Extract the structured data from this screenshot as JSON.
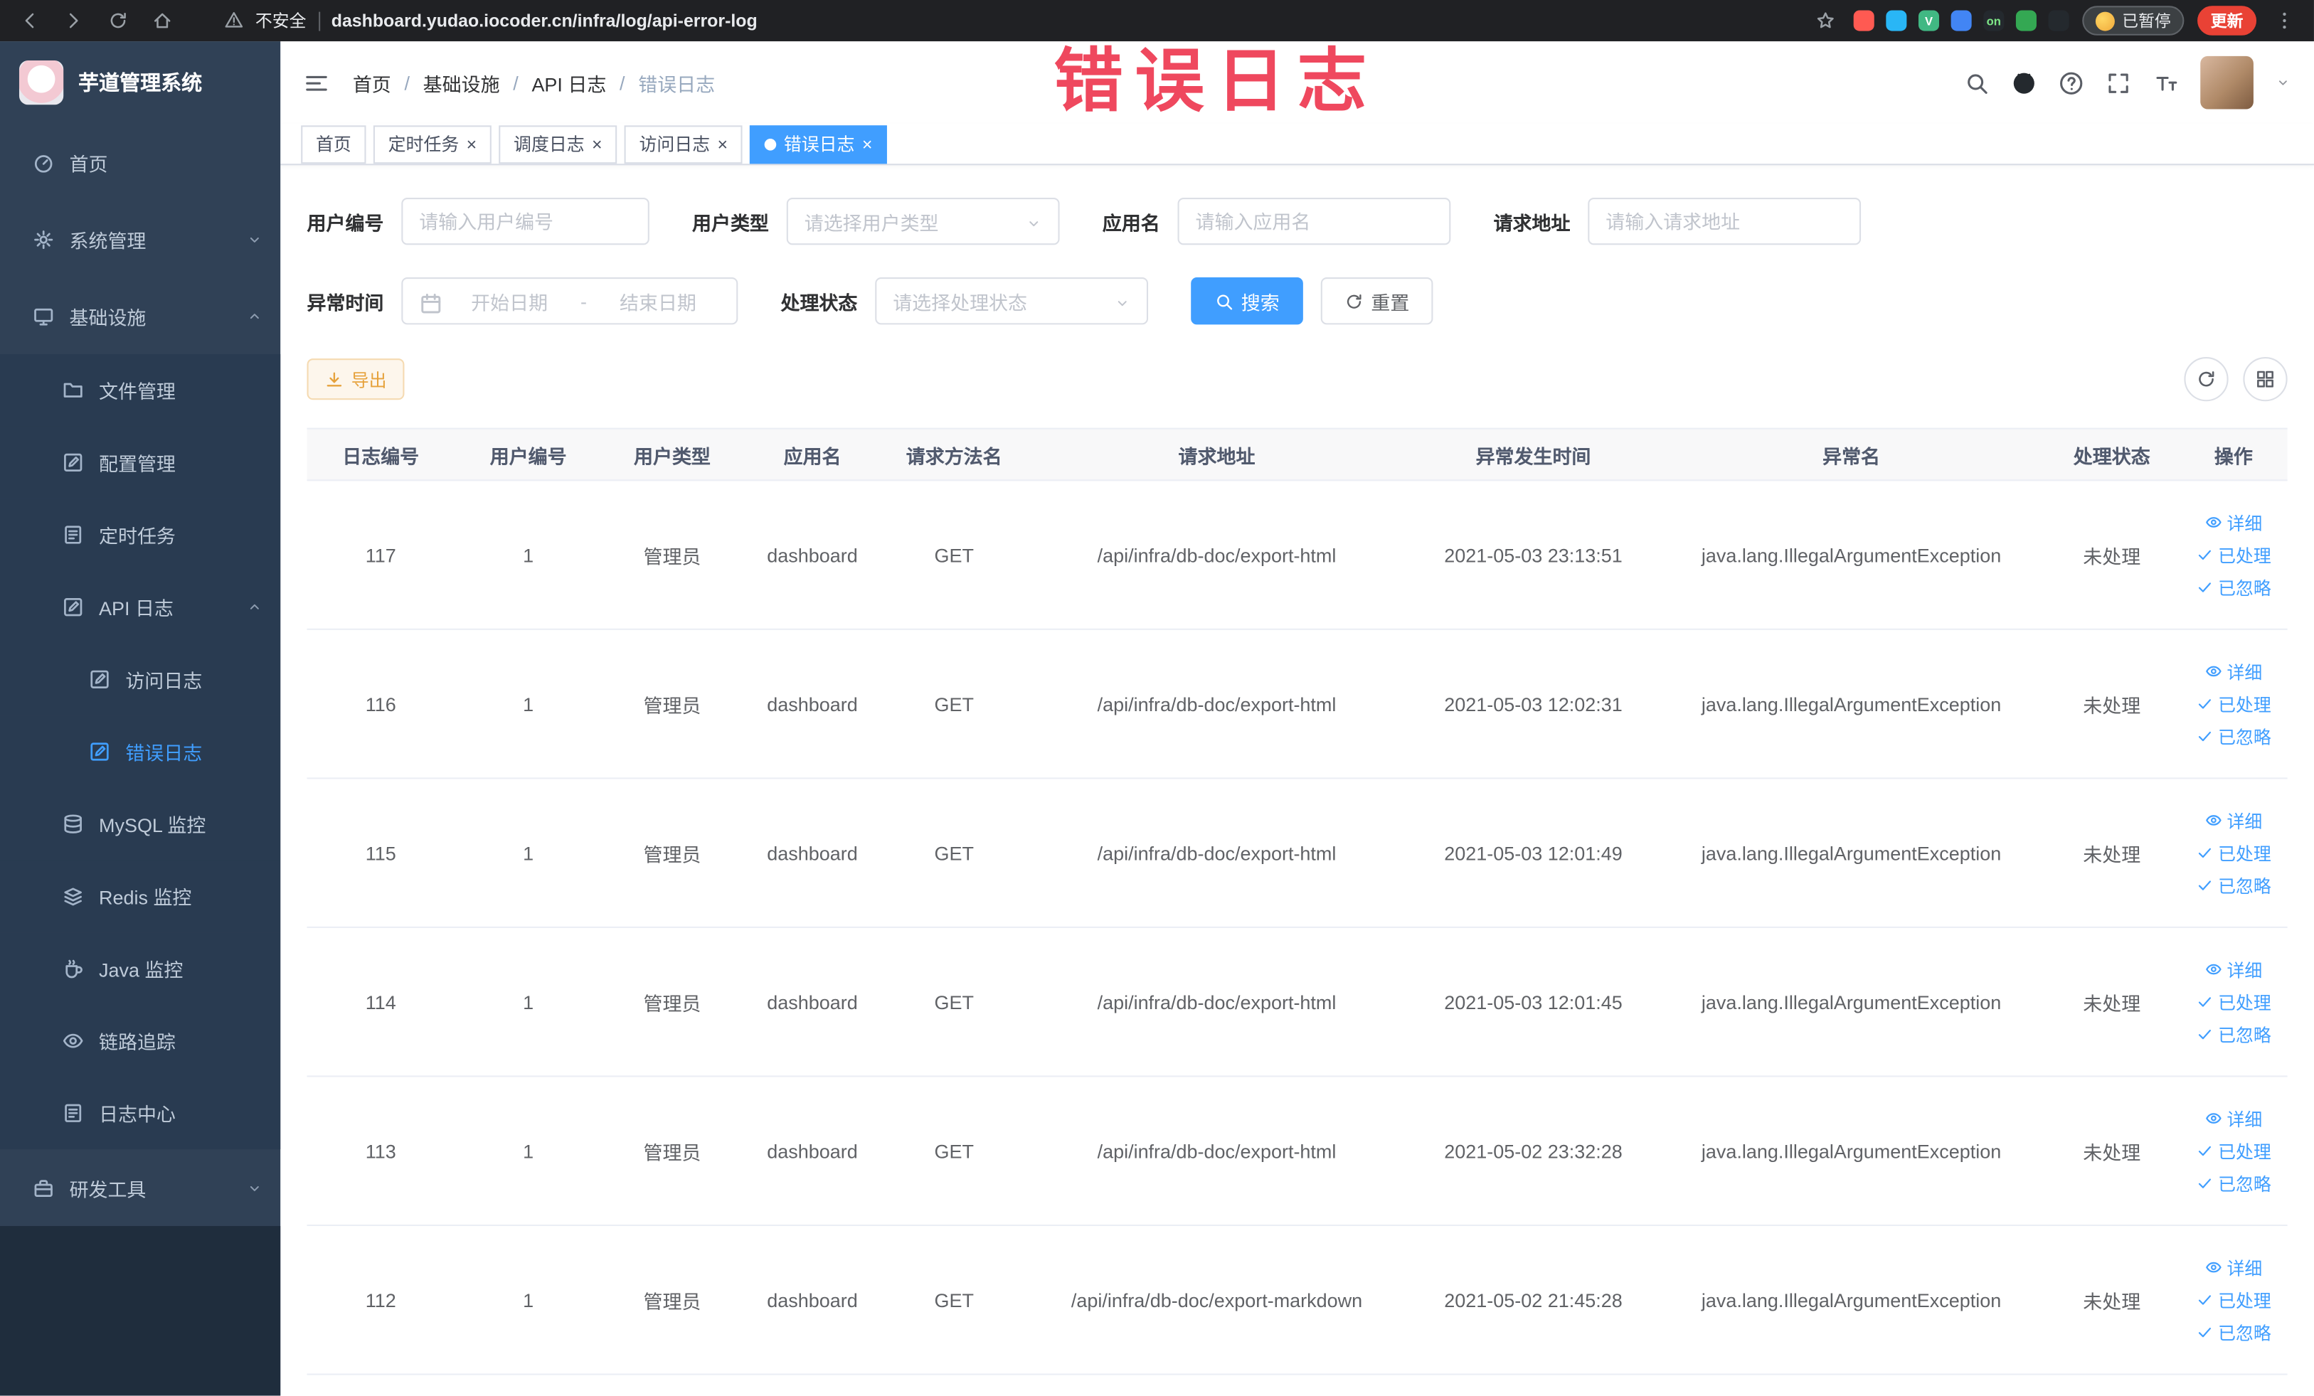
{
  "browser": {
    "security_label": "不安全",
    "url": "dashboard.yudao.iocoder.cn/infra/log/api-error-log",
    "paused_chip": "已暂停",
    "update_button": "更新",
    "extensions": [
      {
        "key": "ext-red",
        "color": "#ff5a52",
        "text": ""
      },
      {
        "key": "ext-drop",
        "color": "#29b6f6",
        "text": ""
      },
      {
        "key": "ext-vue",
        "color": "#41b883",
        "text": "V"
      },
      {
        "key": "ext-grid",
        "color": "#4285f4",
        "text": ""
      },
      {
        "key": "ext-on",
        "color": "#24292e",
        "text": "on",
        "text_color": "#7ee787"
      },
      {
        "key": "ext-green",
        "color": "#34a853",
        "text": ""
      },
      {
        "key": "ext-dark",
        "color": "#24292e",
        "text": ""
      }
    ]
  },
  "watermark": "错误日志",
  "sidebar": {
    "logo_title": "芋道管理系统",
    "items": [
      {
        "key": "home",
        "label": "首页",
        "icon": "dashboard",
        "level": 1
      },
      {
        "key": "system-mgmt",
        "label": "系统管理",
        "icon": "gear",
        "level": 1,
        "chevron": "down"
      },
      {
        "key": "infrastructure",
        "label": "基础设施",
        "icon": "monitor",
        "level": 1,
        "chevron": "up"
      },
      {
        "key": "file-mgmt",
        "label": "文件管理",
        "icon": "folder",
        "level": 2
      },
      {
        "key": "config-mgmt",
        "label": "配置管理",
        "icon": "edit-square",
        "level": 2
      },
      {
        "key": "scheduled-task",
        "label": "定时任务",
        "icon": "list",
        "level": 2
      },
      {
        "key": "api-log",
        "label": "API 日志",
        "icon": "edit-square",
        "level": 2,
        "chevron": "up"
      },
      {
        "key": "access-log",
        "label": "访问日志",
        "icon": "edit-square",
        "level": 3
      },
      {
        "key": "error-log",
        "label": "错误日志",
        "icon": "edit-square",
        "level": 3,
        "active": true
      },
      {
        "key": "mysql-monitor",
        "label": "MySQL 监控",
        "icon": "db",
        "level": 2
      },
      {
        "key": "redis-monitor",
        "label": "Redis 监控",
        "icon": "redis",
        "level": 2
      },
      {
        "key": "java-monitor",
        "label": "Java 监控",
        "icon": "coffee",
        "level": 2
      },
      {
        "key": "trace",
        "label": "链路追踪",
        "icon": "eye",
        "level": 2
      },
      {
        "key": "log-center",
        "label": "日志中心",
        "icon": "list",
        "level": 2
      },
      {
        "key": "dev-tools",
        "label": "研发工具",
        "icon": "toolbox",
        "level": 1,
        "chevron": "down"
      }
    ]
  },
  "header": {
    "breadcrumb": [
      "首页",
      "基础设施",
      "API 日志",
      "错误日志"
    ]
  },
  "tabs": [
    {
      "key": "home",
      "label": "首页",
      "closable": false,
      "active": false
    },
    {
      "key": "scheduled-task",
      "label": "定时任务",
      "closable": true,
      "active": false
    },
    {
      "key": "job-log",
      "label": "调度日志",
      "closable": true,
      "active": false
    },
    {
      "key": "access-log",
      "label": "访问日志",
      "closable": true,
      "active": false
    },
    {
      "key": "error-log",
      "label": "错误日志",
      "closable": true,
      "active": true
    }
  ],
  "filters": {
    "user_id": {
      "label": "用户编号",
      "placeholder": "请输入用户编号"
    },
    "user_type": {
      "label": "用户类型",
      "placeholder": "请选择用户类型"
    },
    "app_name": {
      "label": "应用名",
      "placeholder": "请输入应用名"
    },
    "request_url": {
      "label": "请求地址",
      "placeholder": "请输入请求地址"
    },
    "exception_time": {
      "label": "异常时间",
      "start_placeholder": "开始日期",
      "separator": "-",
      "end_placeholder": "结束日期"
    },
    "process_status": {
      "label": "处理状态",
      "placeholder": "请选择处理状态"
    },
    "search_button": "搜索",
    "reset_button": "重置"
  },
  "toolbar": {
    "export_button": "导出"
  },
  "table": {
    "columns": [
      {
        "key": "log_id",
        "label": "日志编号"
      },
      {
        "key": "user_id",
        "label": "用户编号"
      },
      {
        "key": "user_type",
        "label": "用户类型"
      },
      {
        "key": "app",
        "label": "应用名"
      },
      {
        "key": "method",
        "label": "请求方法名"
      },
      {
        "key": "url",
        "label": "请求地址"
      },
      {
        "key": "time",
        "label": "异常发生时间"
      },
      {
        "key": "exception",
        "label": "异常名"
      },
      {
        "key": "status",
        "label": "处理状态"
      },
      {
        "key": "ops",
        "label": "操作"
      }
    ],
    "rows": [
      {
        "log_id": "117",
        "user_id": "1",
        "user_type": "管理员",
        "app": "dashboard",
        "method": "GET",
        "url": "/api/infra/db-doc/export-html",
        "time": "2021-05-03 23:13:51",
        "exception": "java.lang.IllegalArgumentException",
        "status": "未处理"
      },
      {
        "log_id": "116",
        "user_id": "1",
        "user_type": "管理员",
        "app": "dashboard",
        "method": "GET",
        "url": "/api/infra/db-doc/export-html",
        "time": "2021-05-03 12:02:31",
        "exception": "java.lang.IllegalArgumentException",
        "status": "未处理"
      },
      {
        "log_id": "115",
        "user_id": "1",
        "user_type": "管理员",
        "app": "dashboard",
        "method": "GET",
        "url": "/api/infra/db-doc/export-html",
        "time": "2021-05-03 12:01:49",
        "exception": "java.lang.IllegalArgumentException",
        "status": "未处理"
      },
      {
        "log_id": "114",
        "user_id": "1",
        "user_type": "管理员",
        "app": "dashboard",
        "method": "GET",
        "url": "/api/infra/db-doc/export-html",
        "time": "2021-05-03 12:01:45",
        "exception": "java.lang.IllegalArgumentException",
        "status": "未处理"
      },
      {
        "log_id": "113",
        "user_id": "1",
        "user_type": "管理员",
        "app": "dashboard",
        "method": "GET",
        "url": "/api/infra/db-doc/export-html",
        "time": "2021-05-02 23:32:28",
        "exception": "java.lang.IllegalArgumentException",
        "status": "未处理"
      },
      {
        "log_id": "112",
        "user_id": "1",
        "user_type": "管理员",
        "app": "dashboard",
        "method": "GET",
        "url": "/api/infra/db-doc/export-markdown",
        "time": "2021-05-02 21:45:28",
        "exception": "java.lang.IllegalArgumentException",
        "status": "未处理"
      }
    ],
    "row_actions": {
      "detail": "详细",
      "processed": "已处理",
      "ignored": "已忽略"
    }
  },
  "colors": {
    "primary": "#409eff",
    "warning": "#e6a23c",
    "watermark": "#ee3b52",
    "sidebar_bg": "#304156",
    "submenu_bg": "#1f2d3d"
  }
}
